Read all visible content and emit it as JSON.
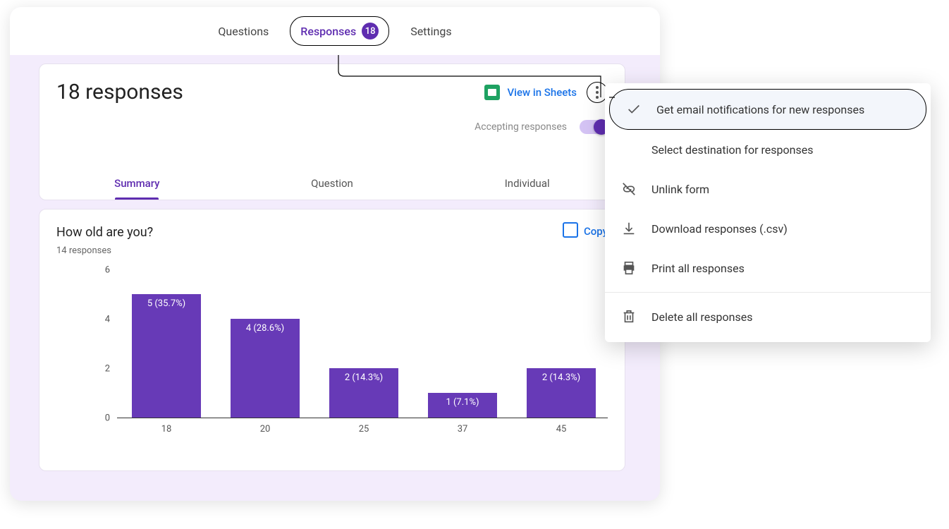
{
  "tabs": {
    "questions": "Questions",
    "responses": "Responses",
    "responses_badge": "18",
    "settings": "Settings"
  },
  "responses": {
    "title": "18 responses",
    "view_sheets": "View in Sheets",
    "accepting_label": "Accepting responses"
  },
  "sub_tabs": {
    "summary": "Summary",
    "question": "Question",
    "individual": "Individual"
  },
  "chart_head": {
    "title": "How old are you?",
    "subtitle": "14 responses",
    "copy": "Copy"
  },
  "chart_data": {
    "type": "bar",
    "title": "How old are you?",
    "xlabel": "",
    "ylabel": "",
    "ylim": [
      0,
      6
    ],
    "yticks": [
      0,
      2,
      4,
      6
    ],
    "categories": [
      "18",
      "20",
      "25",
      "37",
      "45"
    ],
    "values": [
      5,
      4,
      2,
      1,
      2
    ],
    "percent": [
      "35.7%",
      "28.6%",
      "14.3%",
      "7.1%",
      "14.3%"
    ]
  },
  "menu": {
    "notifications": "Get email notifications for new responses",
    "destination": "Select destination for responses",
    "unlink": "Unlink form",
    "download": "Download responses (.csv)",
    "print": "Print all responses",
    "delete": "Delete all responses"
  }
}
